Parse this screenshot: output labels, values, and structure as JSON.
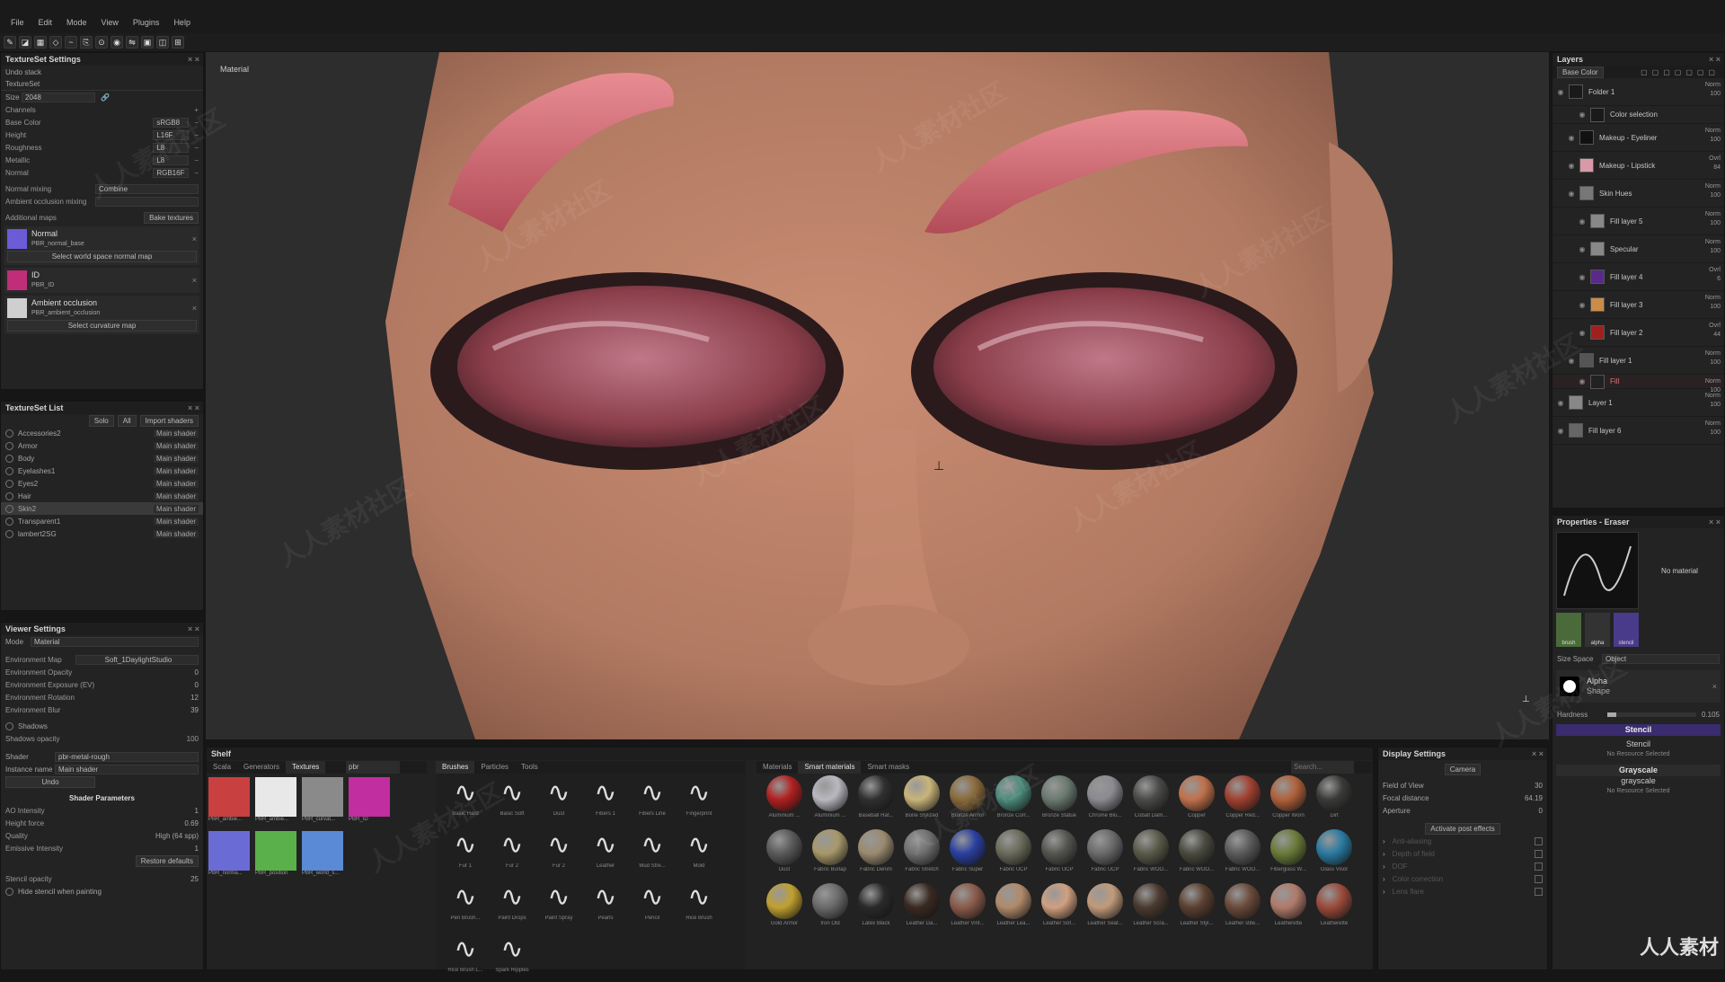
{
  "menu": [
    "File",
    "Edit",
    "Mode",
    "View",
    "Plugins",
    "Help"
  ],
  "texset": {
    "title": "TextureSet Settings",
    "undo": "Undo stack",
    "textureset": "TextureSet",
    "size_label": "Size",
    "size_value": "2048",
    "channels_label": "Channels",
    "channels": [
      {
        "name": "Base Color",
        "format": "sRGB8"
      },
      {
        "name": "Height",
        "format": "L16F"
      },
      {
        "name": "Roughness",
        "format": "L8"
      },
      {
        "name": "Metallic",
        "format": "L8"
      },
      {
        "name": "Normal",
        "format": "RGB16F"
      }
    ],
    "normal_mixing_label": "Normal mixing",
    "normal_mixing_value": "Combine",
    "ao_mixing_label": "Ambient occlusion mixing",
    "additional_maps": "Additional maps",
    "bake_button": "Bake textures",
    "maps": [
      {
        "name": "Normal",
        "file": "PBR_normal_base",
        "btn": "Select world space normal map",
        "color": "#6b5bd6"
      },
      {
        "name": "ID",
        "file": "PBR_ID",
        "btn": "",
        "color": "#c02e7a"
      },
      {
        "name": "Ambient occlusion",
        "file": "PBR_ambient_occlusion",
        "btn": "Select curvature map",
        "color": "#cfcfcf"
      }
    ]
  },
  "tslist": {
    "title": "TextureSet List",
    "solo": "Solo",
    "all": "All",
    "import": "Import shaders",
    "items": [
      {
        "name": "Accessories2",
        "shader": "Main shader"
      },
      {
        "name": "Armor",
        "shader": "Main shader"
      },
      {
        "name": "Body",
        "shader": "Main shader"
      },
      {
        "name": "Eyelashes1",
        "shader": "Main shader"
      },
      {
        "name": "Eyes2",
        "shader": "Main shader"
      },
      {
        "name": "Hair",
        "shader": "Main shader"
      },
      {
        "name": "Skin2",
        "shader": "Main shader"
      },
      {
        "name": "Transparent1",
        "shader": "Main shader"
      },
      {
        "name": "lambert2SG",
        "shader": "Main shader"
      }
    ]
  },
  "viewer": {
    "title": "Viewer Settings",
    "mode_label": "Mode",
    "mode_value": "Material",
    "env_map_label": "Environment Map",
    "env_map_value": "Soft_1DaylightStudio",
    "sliders": [
      {
        "label": "Environment Opacity",
        "value": "0"
      },
      {
        "label": "Environment Exposure (EV)",
        "value": "0"
      },
      {
        "label": "Environment Rotation",
        "value": "12"
      },
      {
        "label": "Environment Blur",
        "value": "39"
      }
    ],
    "shadows_label": "Shadows",
    "shadows_opacity_label": "Shadows opacity",
    "shadows_opacity_value": "100",
    "shader_label": "Shader",
    "shader_value": "pbr-metal-rough",
    "instance_label": "Instance name",
    "instance_value": "Main shader",
    "undo": "Undo",
    "shader_params_title": "Shader Parameters",
    "params": [
      {
        "label": "AO Intensity",
        "value": "1"
      },
      {
        "label": "Height force",
        "value": "0.69"
      },
      {
        "label": "Quality",
        "value": "High (64 spp)"
      },
      {
        "label": "Emissive Intensity",
        "value": "1"
      }
    ],
    "restore": "Restore defaults",
    "stencil_opacity_label": "Stencil opacity",
    "stencil_opacity_value": "25",
    "hide_stencil": "Hide stencil when painting"
  },
  "viewport": {
    "label": "Material"
  },
  "layers": {
    "title": "Layers",
    "blend": "Base Color",
    "items": [
      {
        "name": "Folder 1",
        "blend": "Norm",
        "op": "100",
        "color": "#1a1a1a",
        "indent": 0
      },
      {
        "name": "Color selection",
        "blend": "",
        "op": "",
        "color": "#1a1a1a",
        "indent": 2
      },
      {
        "name": "Makeup - Eyeliner",
        "blend": "Norm",
        "op": "100",
        "color": "#111",
        "indent": 1
      },
      {
        "name": "Makeup - Lipstick",
        "blend": "Ovrl",
        "op": "84",
        "color": "#d89aa8",
        "indent": 1
      },
      {
        "name": "Skin Hues",
        "blend": "Norm",
        "op": "100",
        "color": "#777",
        "indent": 1
      },
      {
        "name": "Fill layer 5",
        "blend": "Norm",
        "op": "100",
        "color": "#888",
        "indent": 2
      },
      {
        "name": "Specular",
        "blend": "Norm",
        "op": "100",
        "color": "#888",
        "indent": 2
      },
      {
        "name": "Fill layer 4",
        "blend": "Ovrl",
        "op": "6",
        "color": "#5a2a8a",
        "indent": 2
      },
      {
        "name": "Fill layer 3",
        "blend": "Norm",
        "op": "100",
        "color": "#c98c4a",
        "indent": 2
      },
      {
        "name": "Fill layer 2",
        "blend": "Ovrl",
        "op": "44",
        "color": "#a02020",
        "indent": 2
      },
      {
        "name": "Fill layer 1",
        "blend": "Norm",
        "op": "100",
        "color": "#555",
        "indent": 1
      },
      {
        "name": "Fill",
        "blend": "Norm",
        "op": "100",
        "color": "#222",
        "indent": 2
      },
      {
        "name": "Layer 1",
        "blend": "Norm",
        "op": "100",
        "color": "#888",
        "indent": 0
      },
      {
        "name": "Fill layer 6",
        "blend": "Norm",
        "op": "100",
        "color": "#666",
        "indent": 0
      }
    ]
  },
  "props": {
    "title": "Properties - Eraser",
    "no_material": "No material",
    "tools": [
      "brush",
      "alpha",
      "stencil"
    ],
    "size_space_label": "Size Space",
    "size_space_value": "Object",
    "alpha_label": "Alpha",
    "alpha_sub": "Shape",
    "hardness_label": "Hardness",
    "hardness_value": "0.105",
    "stencil_head": "Stencil",
    "stencil_name": "Stencil",
    "stencil_none": "No Resource Selected",
    "grayscale_head": "Grayscale",
    "grayscale_name": "grayscale",
    "grayscale_none": "No Resource Selected"
  },
  "shelf": {
    "title": "Shelf",
    "tabs1": [
      "Scala",
      "Generators",
      "Textures"
    ],
    "search1": "pbr",
    "textures": [
      {
        "name": "PBR_ambie...",
        "color": "#c84040"
      },
      {
        "name": "PBR_ambie...",
        "color": "#e8e8e8"
      },
      {
        "name": "PBR_curvat...",
        "color": "#8a8a8a"
      },
      {
        "name": "PBR_ID",
        "color": "#c02ea0"
      },
      {
        "name": "PBR_norma...",
        "color": "#6b6bd6"
      },
      {
        "name": "PBR_position",
        "color": "#5ab04a"
      },
      {
        "name": "PBR_world_s...",
        "color": "#5a8ad6"
      }
    ],
    "tabs2": [
      "Brushes",
      "Particles",
      "Tools"
    ],
    "brushes": [
      "Basic Hard",
      "Basic Soft",
      "Dust",
      "Fibers 1",
      "Fibers Line",
      "Fingerprint",
      "Fur 1",
      "Fur 2",
      "Fur 2",
      "Leather",
      "Mud Stre...",
      "Mold",
      "Pen Brush...",
      "Paint Drops",
      "Paint Spray",
      "Pearls",
      "Pencil",
      "Rice Brush",
      "Rice Brush L...",
      "Spark Ripples"
    ],
    "tabs3": [
      "Materials",
      "Smart materials",
      "Smart masks"
    ],
    "search3": "Search...",
    "materials": [
      {
        "name": "Aluminium ...",
        "color": "#b02020"
      },
      {
        "name": "Aluminium ...",
        "color": "#b8b8c0"
      },
      {
        "name": "Baseball Hat...",
        "color": "#303030"
      },
      {
        "name": "Bone Stylized",
        "color": "#c9b47a"
      },
      {
        "name": "Bronze Armor",
        "color": "#8a6a3a"
      },
      {
        "name": "Bronze Corr...",
        "color": "#4a8a7a"
      },
      {
        "name": "Bronze Statue",
        "color": "#6a7a70"
      },
      {
        "name": "Chrome Blu...",
        "color": "#8a8a90"
      },
      {
        "name": "Cobalt Dam...",
        "color": "#4a4a48"
      },
      {
        "name": "Copper",
        "color": "#c0704a"
      },
      {
        "name": "Copper Red...",
        "color": "#a04030"
      },
      {
        "name": "Copper Worn",
        "color": "#b0603a"
      },
      {
        "name": "Dirt",
        "color": "#3a3a38"
      },
      {
        "name": "Dust",
        "color": "#5a5a5a"
      },
      {
        "name": "Fabric Burlap",
        "color": "#a8986a"
      },
      {
        "name": "Fabric Denim",
        "color": "#9a8a70"
      },
      {
        "name": "Fabric Stretch",
        "color": "#707070"
      },
      {
        "name": "Fabric Super",
        "color": "#2a40a0"
      },
      {
        "name": "Fabric UCP",
        "color": "#6a6a5a"
      },
      {
        "name": "Fabric UCP",
        "color": "#555550"
      },
      {
        "name": "Fabric UCP",
        "color": "#6a6a6a"
      },
      {
        "name": "Fabric WOO...",
        "color": "#5a5a4a"
      },
      {
        "name": "Fabric WOO...",
        "color": "#4a4a40"
      },
      {
        "name": "Fabric WOO...",
        "color": "#5a5a5a"
      },
      {
        "name": "Fiberglass W...",
        "color": "#6a7a3a"
      },
      {
        "name": "Glass Visor",
        "color": "#2a7aa0"
      },
      {
        "name": "Gold Armor",
        "color": "#c0a030"
      },
      {
        "name": "Iron Old",
        "color": "#6a6a6a"
      },
      {
        "name": "Latex Black",
        "color": "#2a2a2a"
      },
      {
        "name": "Leather Da...",
        "color": "#3a2a22"
      },
      {
        "name": "Leather Vint...",
        "color": "#8a5a4a"
      },
      {
        "name": "Leather Lea...",
        "color": "#b08a6a"
      },
      {
        "name": "Leather Sof...",
        "color": "#d0a080"
      },
      {
        "name": "Leather Seat...",
        "color": "#c09a7a"
      },
      {
        "name": "Leather Scra...",
        "color": "#4a3a30"
      },
      {
        "name": "Leather Styl...",
        "color": "#5a4030"
      },
      {
        "name": "Leather stite...",
        "color": "#6a4a3a"
      },
      {
        "name": "Leatherette",
        "color": "#b07a6a"
      },
      {
        "name": "Leatherette",
        "color": "#9a4a3a"
      }
    ]
  },
  "display": {
    "title": "Display Settings",
    "camera": "Camera",
    "fov_label": "Field of View",
    "fov_value": "30",
    "focal_label": "Focal distance",
    "focal_value": "64.19",
    "aperture_label": "Aperture",
    "aperture_value": "0",
    "post_effects": "Activate post effects",
    "effects": [
      "Anti-aliasing",
      "Depth of field",
      "DOF",
      "Color correction",
      "Lens flare"
    ]
  },
  "watermark": "人人素材社区",
  "brand_text": "人人素材",
  "colors": {
    "accent": "#4a3a8a",
    "stencil": "#3a2c6e"
  }
}
